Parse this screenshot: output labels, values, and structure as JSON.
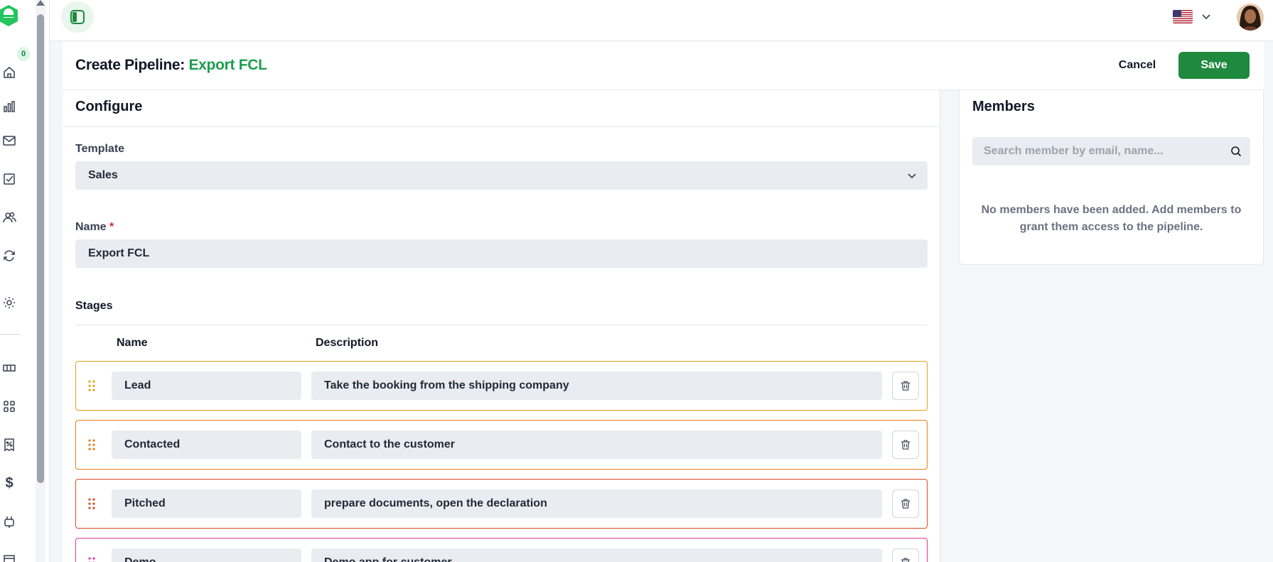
{
  "rail": {
    "badge": "0",
    "nav_items": [
      "home",
      "reports",
      "mail",
      "tasks",
      "contacts",
      "sync",
      "settings",
      "deals",
      "apps",
      "invoices",
      "payments",
      "integrations",
      "calendar"
    ]
  },
  "header": {
    "title_prefix": "Create Pipeline:",
    "title_name": "Export FCL",
    "cancel_label": "Cancel",
    "save_label": "Save",
    "language": "us-flag-icon"
  },
  "configure": {
    "title": "Configure",
    "template_label": "Template",
    "template_value": "Sales",
    "name_label": "Name",
    "name_required": "*",
    "name_value": "Export FCL",
    "stages_label": "Stages",
    "col_name": "Name",
    "col_description": "Description",
    "stages": [
      {
        "name": "Lead",
        "description": "Take the booking from the shipping company",
        "color": "#e0a21b"
      },
      {
        "name": "Contacted",
        "description": "Contact to the customer",
        "color": "#ea7f1c"
      },
      {
        "name": "Pitched",
        "description": "prepare documents, open the declaration",
        "color": "#dc4a26"
      },
      {
        "name": "Demo",
        "description": "Demo app for customer",
        "color": "#e0389a"
      }
    ]
  },
  "members": {
    "title": "Members",
    "search_placeholder": "Search member by email, name...",
    "empty_message": "No members have been added. Add members to grant them access to the pipeline."
  },
  "colors": {
    "brand_green": "#1f8a3e",
    "title_accent": "#1e9e4e"
  }
}
